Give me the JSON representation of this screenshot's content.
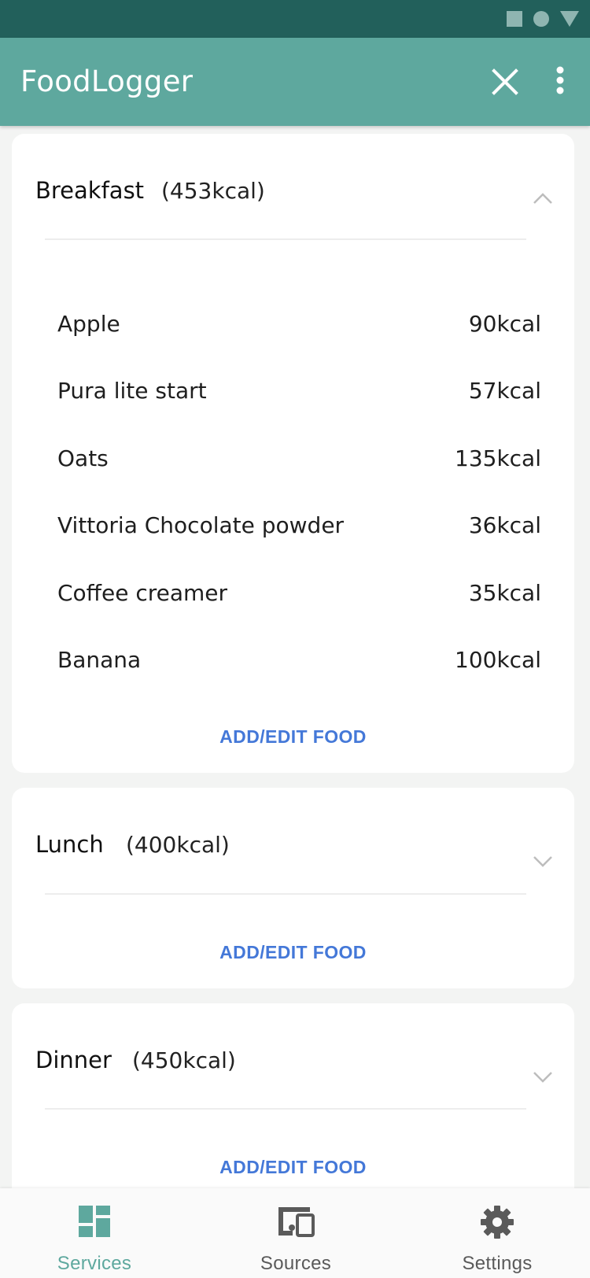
{
  "app": {
    "title": "FoodLogger"
  },
  "colors": {
    "status_bar": "#22605b",
    "app_bar": "#5ea89e",
    "accent_text": "#4478d8",
    "active_tab": "#5ea89e",
    "inactive_tab": "#5a5a5a"
  },
  "toolbar": {
    "close_icon": "close-icon",
    "more_icon": "more-vertical-icon"
  },
  "meals": [
    {
      "name": "Breakfast",
      "kcal": "(453kcal)",
      "expanded": true,
      "items": [
        {
          "name": "Apple",
          "kcal": "90kcal"
        },
        {
          "name": "Pura lite start",
          "kcal": "57kcal"
        },
        {
          "name": "Oats",
          "kcal": "135kcal"
        },
        {
          "name": "Vittoria Chocolate powder",
          "kcal": "36kcal"
        },
        {
          "name": "Coffee creamer",
          "kcal": "35kcal"
        },
        {
          "name": "Banana",
          "kcal": "100kcal"
        }
      ],
      "action": "ADD/EDIT FOOD"
    },
    {
      "name": "Lunch",
      "kcal": "(400kcal)",
      "expanded": false,
      "items": [],
      "action": "ADD/EDIT FOOD"
    },
    {
      "name": "Dinner",
      "kcal": "(450kcal)",
      "expanded": false,
      "items": [],
      "action": "ADD/EDIT FOOD"
    }
  ],
  "bottom_nav": [
    {
      "label": "Services",
      "icon": "dashboard-icon",
      "active": true
    },
    {
      "label": "Sources",
      "icon": "devices-icon",
      "active": false
    },
    {
      "label": "Settings",
      "icon": "gear-icon",
      "active": false
    }
  ]
}
